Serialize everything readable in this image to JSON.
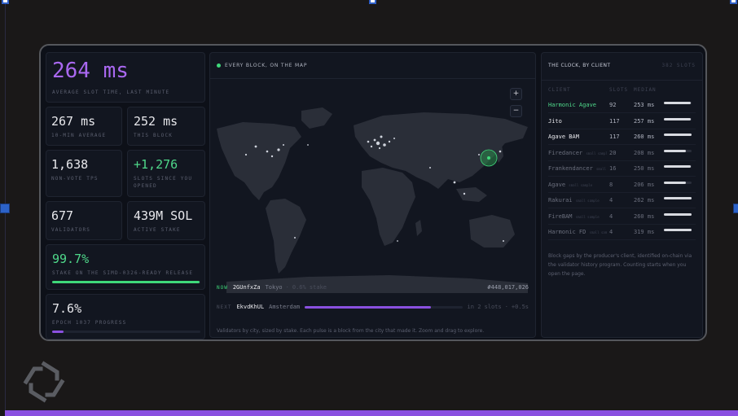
{
  "stats": {
    "avg_slot": {
      "value": "264 ms",
      "label": "AVERAGE SLOT TIME, LAST MINUTE"
    },
    "ten_min": {
      "value": "267 ms",
      "label": "10-MIN AVERAGE"
    },
    "this_block": {
      "value": "252 ms",
      "label": "THIS BLOCK"
    },
    "tps": {
      "value": "1,638",
      "label": "NON-VOTE TPS"
    },
    "slots_since": {
      "value": "+1,276",
      "label": "SLOTS SINCE YOU OPENED"
    },
    "validators": {
      "value": "677",
      "label": "VALIDATORS"
    },
    "stake": {
      "value": "439M SOL",
      "label": "ACTIVE STAKE"
    },
    "release": {
      "value": "99.7%",
      "label": "STAKE ON THE SIMD-0326-READY RELEASE",
      "progress": 0.997,
      "color": "#3fd87a"
    },
    "epoch": {
      "value": "7.6%",
      "label": "EPOCH 1037 PROGRESS",
      "progress": 0.076,
      "color": "#8a50e0"
    }
  },
  "map": {
    "header": "EVERY BLOCK, ON THE MAP",
    "zoom_in": "+",
    "zoom_out": "−",
    "now": {
      "tag": "NOW",
      "id": "2GUnfxZa",
      "city": "Tokyo",
      "sep": "·",
      "stake": "0.6% stake",
      "slot": "#448,017,026"
    },
    "next": {
      "tag": "NEXT",
      "id": "EkvdKhUL",
      "city": "Amsterdam",
      "eta": "in 2 slots",
      "sep": "·",
      "delta": "+0.5s",
      "progress": 0.8
    },
    "caption": "Validators by city, sized by stake. Each pulse is a block from the city that made it. Zoom and drag to explore."
  },
  "clients": {
    "title": "THE CLOCK, BY CLIENT",
    "count": "382 SLOTS",
    "columns": [
      "CLIENT",
      "SLOTS",
      "MEDIAN"
    ],
    "rows": [
      {
        "name": "Harmonic Agave",
        "note": "",
        "slots": "92",
        "median": "253 ms",
        "bar": 0.97,
        "color": "#4fd88a"
      },
      {
        "name": "Jito",
        "note": "",
        "slots": "117",
        "median": "257 ms",
        "bar": 0.98,
        "color": "#e8e8ec"
      },
      {
        "name": "Agave BAM",
        "note": "",
        "slots": "117",
        "median": "260 ms",
        "bar": 0.99,
        "color": "#e8e8ec"
      },
      {
        "name": "Firedancer",
        "note": "small sample",
        "slots": "20",
        "median": "208 ms",
        "bar": 0.8,
        "color": "#6a6e7c"
      },
      {
        "name": "Frankendancer",
        "note": "small sample",
        "slots": "16",
        "median": "250 ms",
        "bar": 0.96,
        "color": "#6a6e7c"
      },
      {
        "name": "Agave",
        "note": "small sample",
        "slots": "8",
        "median": "206 ms",
        "bar": 0.79,
        "color": "#6a6e7c"
      },
      {
        "name": "Rakurai",
        "note": "small sample",
        "slots": "4",
        "median": "262 ms",
        "bar": 1.0,
        "color": "#6a6e7c"
      },
      {
        "name": "FireBAM",
        "note": "small sample",
        "slots": "4",
        "median": "260 ms",
        "bar": 0.99,
        "color": "#6a6e7c"
      },
      {
        "name": "Harmonic FD",
        "note": "small sample",
        "slots": "4",
        "median": "319 ms",
        "bar": 1.0,
        "color": "#6a6e7c"
      }
    ],
    "note": "Block gaps by the producer's client, identified on-chain via the validator history program. Counting starts when you open the page."
  },
  "icons": {
    "logo": "solana-like-logo-icon"
  }
}
